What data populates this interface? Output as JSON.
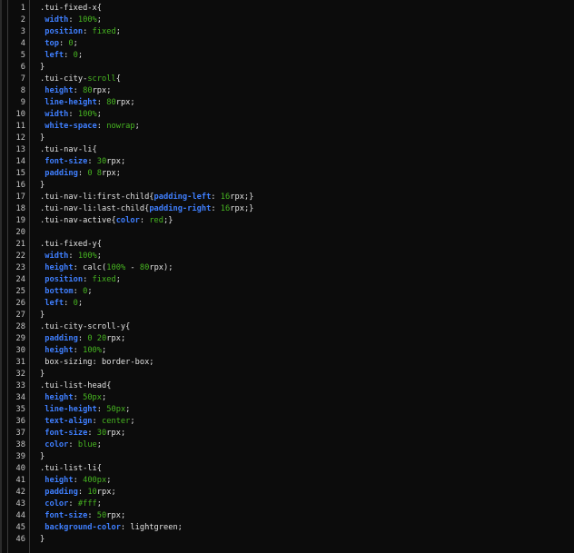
{
  "editor": {
    "lines": [
      {
        "n": "1",
        "parts": [
          {
            "t": "sel",
            "v": ".tui-fixed-x{"
          }
        ]
      },
      {
        "n": "2",
        "parts": [
          {
            "t": "sp",
            "v": " "
          },
          {
            "t": "prop",
            "v": "width"
          },
          {
            "t": "punc",
            "v": ": "
          },
          {
            "t": "val",
            "v": "100%"
          },
          {
            "t": "punc",
            "v": ";"
          }
        ]
      },
      {
        "n": "3",
        "parts": [
          {
            "t": "sp",
            "v": " "
          },
          {
            "t": "prop",
            "v": "position"
          },
          {
            "t": "punc",
            "v": ": "
          },
          {
            "t": "val",
            "v": "fixed"
          },
          {
            "t": "punc",
            "v": ";"
          }
        ]
      },
      {
        "n": "4",
        "parts": [
          {
            "t": "sp",
            "v": " "
          },
          {
            "t": "prop",
            "v": "top"
          },
          {
            "t": "punc",
            "v": ": "
          },
          {
            "t": "val",
            "v": "0"
          },
          {
            "t": "punc",
            "v": ";"
          }
        ]
      },
      {
        "n": "5",
        "parts": [
          {
            "t": "sp",
            "v": " "
          },
          {
            "t": "prop",
            "v": "left"
          },
          {
            "t": "punc",
            "v": ": "
          },
          {
            "t": "val",
            "v": "0"
          },
          {
            "t": "punc",
            "v": ";"
          }
        ]
      },
      {
        "n": "6",
        "parts": [
          {
            "t": "sel",
            "v": "}"
          }
        ]
      },
      {
        "n": "7",
        "parts": [
          {
            "t": "sel",
            "v": ".tui-city-"
          },
          {
            "t": "val",
            "v": "scroll"
          },
          {
            "t": "sel",
            "v": "{"
          }
        ]
      },
      {
        "n": "8",
        "parts": [
          {
            "t": "sp",
            "v": " "
          },
          {
            "t": "prop",
            "v": "height"
          },
          {
            "t": "punc",
            "v": ": "
          },
          {
            "t": "val",
            "v": "80"
          },
          {
            "t": "punc",
            "v": "rpx;"
          }
        ]
      },
      {
        "n": "9",
        "parts": [
          {
            "t": "sp",
            "v": " "
          },
          {
            "t": "prop",
            "v": "line-height"
          },
          {
            "t": "punc",
            "v": ": "
          },
          {
            "t": "val",
            "v": "80"
          },
          {
            "t": "punc",
            "v": "rpx;"
          }
        ]
      },
      {
        "n": "10",
        "parts": [
          {
            "t": "sp",
            "v": " "
          },
          {
            "t": "prop",
            "v": "width"
          },
          {
            "t": "punc",
            "v": ": "
          },
          {
            "t": "val",
            "v": "100%"
          },
          {
            "t": "punc",
            "v": ";"
          }
        ]
      },
      {
        "n": "11",
        "parts": [
          {
            "t": "sp",
            "v": " "
          },
          {
            "t": "prop",
            "v": "white-space"
          },
          {
            "t": "punc",
            "v": ": "
          },
          {
            "t": "val",
            "v": "nowrap"
          },
          {
            "t": "punc",
            "v": ";"
          }
        ]
      },
      {
        "n": "12",
        "parts": [
          {
            "t": "sel",
            "v": "}"
          }
        ]
      },
      {
        "n": "13",
        "parts": [
          {
            "t": "sel",
            "v": ".tui-nav-li{"
          }
        ]
      },
      {
        "n": "14",
        "parts": [
          {
            "t": "sp",
            "v": " "
          },
          {
            "t": "prop",
            "v": "font-size"
          },
          {
            "t": "punc",
            "v": ": "
          },
          {
            "t": "val",
            "v": "30"
          },
          {
            "t": "punc",
            "v": "rpx;"
          }
        ]
      },
      {
        "n": "15",
        "parts": [
          {
            "t": "sp",
            "v": " "
          },
          {
            "t": "prop",
            "v": "padding"
          },
          {
            "t": "punc",
            "v": ": "
          },
          {
            "t": "val",
            "v": "0 8"
          },
          {
            "t": "punc",
            "v": "rpx;"
          }
        ]
      },
      {
        "n": "16",
        "parts": [
          {
            "t": "sel",
            "v": "}"
          }
        ]
      },
      {
        "n": "17",
        "parts": [
          {
            "t": "sel",
            "v": ".tui-nav-li:first-child{"
          },
          {
            "t": "prop",
            "v": "padding-left"
          },
          {
            "t": "punc",
            "v": ": "
          },
          {
            "t": "val",
            "v": "16"
          },
          {
            "t": "punc",
            "v": "rpx;}"
          }
        ]
      },
      {
        "n": "18",
        "parts": [
          {
            "t": "sel",
            "v": ".tui-nav-li:last-child{"
          },
          {
            "t": "prop",
            "v": "padding-right"
          },
          {
            "t": "punc",
            "v": ": "
          },
          {
            "t": "val",
            "v": "16"
          },
          {
            "t": "punc",
            "v": "rpx;}"
          }
        ]
      },
      {
        "n": "19",
        "parts": [
          {
            "t": "sel",
            "v": ".tui-nav-active{"
          },
          {
            "t": "prop",
            "v": "color"
          },
          {
            "t": "punc",
            "v": ": "
          },
          {
            "t": "val",
            "v": "red"
          },
          {
            "t": "punc",
            "v": ";}"
          }
        ]
      },
      {
        "n": "20",
        "parts": []
      },
      {
        "n": "21",
        "parts": [
          {
            "t": "sel",
            "v": ".tui-fixed-y{"
          }
        ]
      },
      {
        "n": "22",
        "parts": [
          {
            "t": "sp",
            "v": " "
          },
          {
            "t": "prop",
            "v": "width"
          },
          {
            "t": "punc",
            "v": ": "
          },
          {
            "t": "val",
            "v": "100%"
          },
          {
            "t": "punc",
            "v": ";"
          }
        ]
      },
      {
        "n": "23",
        "parts": [
          {
            "t": "sp",
            "v": " "
          },
          {
            "t": "prop",
            "v": "height"
          },
          {
            "t": "punc",
            "v": ": calc("
          },
          {
            "t": "val",
            "v": "100%"
          },
          {
            "t": "punc",
            "v": " - "
          },
          {
            "t": "val",
            "v": "80"
          },
          {
            "t": "punc",
            "v": "rpx);"
          }
        ]
      },
      {
        "n": "24",
        "parts": [
          {
            "t": "sp",
            "v": " "
          },
          {
            "t": "prop",
            "v": "position"
          },
          {
            "t": "punc",
            "v": ": "
          },
          {
            "t": "val",
            "v": "fixed"
          },
          {
            "t": "punc",
            "v": ";"
          }
        ]
      },
      {
        "n": "25",
        "parts": [
          {
            "t": "sp",
            "v": " "
          },
          {
            "t": "prop",
            "v": "bottom"
          },
          {
            "t": "punc",
            "v": ": "
          },
          {
            "t": "val",
            "v": "0"
          },
          {
            "t": "punc",
            "v": ";"
          }
        ]
      },
      {
        "n": "26",
        "parts": [
          {
            "t": "sp",
            "v": " "
          },
          {
            "t": "prop",
            "v": "left"
          },
          {
            "t": "punc",
            "v": ": "
          },
          {
            "t": "val",
            "v": "0"
          },
          {
            "t": "punc",
            "v": ";"
          }
        ]
      },
      {
        "n": "27",
        "parts": [
          {
            "t": "sel",
            "v": "}"
          }
        ]
      },
      {
        "n": "28",
        "parts": [
          {
            "t": "sel",
            "v": ".tui-city-scroll-y{"
          }
        ]
      },
      {
        "n": "29",
        "parts": [
          {
            "t": "sp",
            "v": " "
          },
          {
            "t": "prop",
            "v": "padding"
          },
          {
            "t": "punc",
            "v": ": "
          },
          {
            "t": "val",
            "v": "0 20"
          },
          {
            "t": "punc",
            "v": "rpx;"
          }
        ]
      },
      {
        "n": "30",
        "parts": [
          {
            "t": "sp",
            "v": " "
          },
          {
            "t": "prop",
            "v": "height"
          },
          {
            "t": "punc",
            "v": ": "
          },
          {
            "t": "val",
            "v": "100%"
          },
          {
            "t": "punc",
            "v": ";"
          }
        ]
      },
      {
        "n": "31",
        "parts": [
          {
            "t": "sp",
            "v": " "
          },
          {
            "t": "punc",
            "v": "box-sizing: border-box;"
          }
        ]
      },
      {
        "n": "32",
        "parts": [
          {
            "t": "sel",
            "v": "}"
          }
        ]
      },
      {
        "n": "33",
        "parts": [
          {
            "t": "sel",
            "v": ".tui-list-head{"
          }
        ]
      },
      {
        "n": "34",
        "parts": [
          {
            "t": "sp",
            "v": " "
          },
          {
            "t": "prop",
            "v": "height"
          },
          {
            "t": "punc",
            "v": ": "
          },
          {
            "t": "val",
            "v": "50px"
          },
          {
            "t": "punc",
            "v": ";"
          }
        ]
      },
      {
        "n": "35",
        "parts": [
          {
            "t": "sp",
            "v": " "
          },
          {
            "t": "prop",
            "v": "line-height"
          },
          {
            "t": "punc",
            "v": ": "
          },
          {
            "t": "val",
            "v": "50px"
          },
          {
            "t": "punc",
            "v": ";"
          }
        ]
      },
      {
        "n": "36",
        "parts": [
          {
            "t": "sp",
            "v": " "
          },
          {
            "t": "prop",
            "v": "text-align"
          },
          {
            "t": "punc",
            "v": ": "
          },
          {
            "t": "val",
            "v": "center"
          },
          {
            "t": "punc",
            "v": ";"
          }
        ]
      },
      {
        "n": "37",
        "parts": [
          {
            "t": "sp",
            "v": " "
          },
          {
            "t": "prop",
            "v": "font-size"
          },
          {
            "t": "punc",
            "v": ": "
          },
          {
            "t": "val",
            "v": "30"
          },
          {
            "t": "punc",
            "v": "rpx;"
          }
        ]
      },
      {
        "n": "38",
        "parts": [
          {
            "t": "sp",
            "v": " "
          },
          {
            "t": "prop",
            "v": "color"
          },
          {
            "t": "punc",
            "v": ": "
          },
          {
            "t": "val",
            "v": "blue"
          },
          {
            "t": "punc",
            "v": ";"
          }
        ]
      },
      {
        "n": "39",
        "parts": [
          {
            "t": "sel",
            "v": "}"
          }
        ]
      },
      {
        "n": "40",
        "parts": [
          {
            "t": "sel",
            "v": ".tui-list-li{"
          }
        ]
      },
      {
        "n": "41",
        "parts": [
          {
            "t": "sp",
            "v": " "
          },
          {
            "t": "prop",
            "v": "height"
          },
          {
            "t": "punc",
            "v": ": "
          },
          {
            "t": "val",
            "v": "400px"
          },
          {
            "t": "punc",
            "v": ";"
          }
        ]
      },
      {
        "n": "42",
        "parts": [
          {
            "t": "sp",
            "v": " "
          },
          {
            "t": "prop",
            "v": "padding"
          },
          {
            "t": "punc",
            "v": ": "
          },
          {
            "t": "val",
            "v": "10"
          },
          {
            "t": "punc",
            "v": "rpx;"
          }
        ]
      },
      {
        "n": "43",
        "parts": [
          {
            "t": "sp",
            "v": " "
          },
          {
            "t": "prop",
            "v": "color"
          },
          {
            "t": "punc",
            "v": ": "
          },
          {
            "t": "val",
            "v": "#fff"
          },
          {
            "t": "punc",
            "v": ";"
          }
        ]
      },
      {
        "n": "44",
        "parts": [
          {
            "t": "sp",
            "v": " "
          },
          {
            "t": "prop",
            "v": "font-size"
          },
          {
            "t": "punc",
            "v": ": "
          },
          {
            "t": "val",
            "v": "50"
          },
          {
            "t": "punc",
            "v": "rpx;"
          }
        ]
      },
      {
        "n": "45",
        "parts": [
          {
            "t": "sp",
            "v": " "
          },
          {
            "t": "prop",
            "v": "background-color"
          },
          {
            "t": "punc",
            "v": ": lightgreen;"
          }
        ]
      },
      {
        "n": "46",
        "parts": [
          {
            "t": "sel",
            "v": "}"
          }
        ]
      }
    ]
  },
  "colors": {
    "background": "#0c0c0c",
    "property": "#3f7fff",
    "value": "#47b521",
    "text": "#e2e2e2",
    "line_number": "#c6c6c6"
  }
}
